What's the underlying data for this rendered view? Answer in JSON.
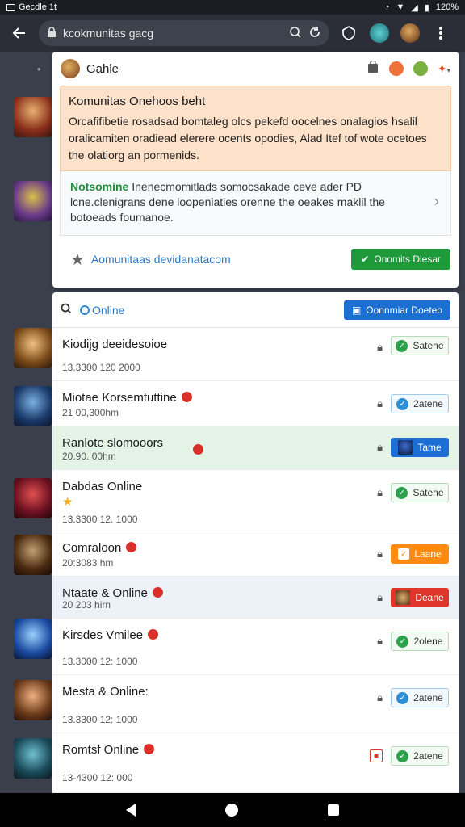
{
  "status_bar": {
    "left_text": "Gecdle 1t",
    "battery": "120%"
  },
  "browser": {
    "url": "kcokmunitas gacg"
  },
  "card": {
    "title": "Gahle",
    "banner_title": "Komunitas Onehoos beht",
    "banner_body": "Orcafifibetie rosadsad bomtaleg olcs pekefd oocelnes onalagios hsalil oralicamiten oradiead elerere ocents opodies, Alad Itef tof wote ocetoes the olatiorg an pormenids.",
    "notice_label": "Notsomine",
    "notice_body": " Inenecmomitlads somocsakade ceve ader PD lcne.clenigrans dene loopeniaties orenne the oeakes maklil the botoeads foumanoe.",
    "community_link": "Aomunitaas devidanatacom",
    "action_button": "Onomits Dlesar"
  },
  "panel": {
    "online_label": "Online",
    "header_button": "Oonnmiar Doeteo",
    "rows": [
      {
        "name": "Kiodijg deeidesoioe",
        "meta": "13.3300   120 2000",
        "pill": "Satene"
      },
      {
        "name": "Miotae Korsemtuttine",
        "meta": "21 00,300hm",
        "pill": "2atene"
      },
      {
        "name": "Ranlote slomooors",
        "meta": "20.90. 00hm",
        "pill": "Tame"
      },
      {
        "name": "Dabdas Online",
        "meta": "13.3300   12. 1000",
        "pill": "Satene"
      },
      {
        "name": "Comraloon",
        "meta": "20:3083 hm",
        "pill": "Laane"
      },
      {
        "name": "Ntaate & Online",
        "meta": "20 203 hirn",
        "pill": "Deane"
      },
      {
        "name": "Kirsdes Vmilee",
        "meta": "13.3000   12: 1000",
        "pill": "2olene"
      },
      {
        "name": "Mesta & Online:",
        "meta": "13.3300   12: 1000",
        "pill": "2atene"
      },
      {
        "name": "Romtsf Online",
        "meta": "13-4300   12: 000",
        "pill": "2atene"
      }
    ]
  }
}
